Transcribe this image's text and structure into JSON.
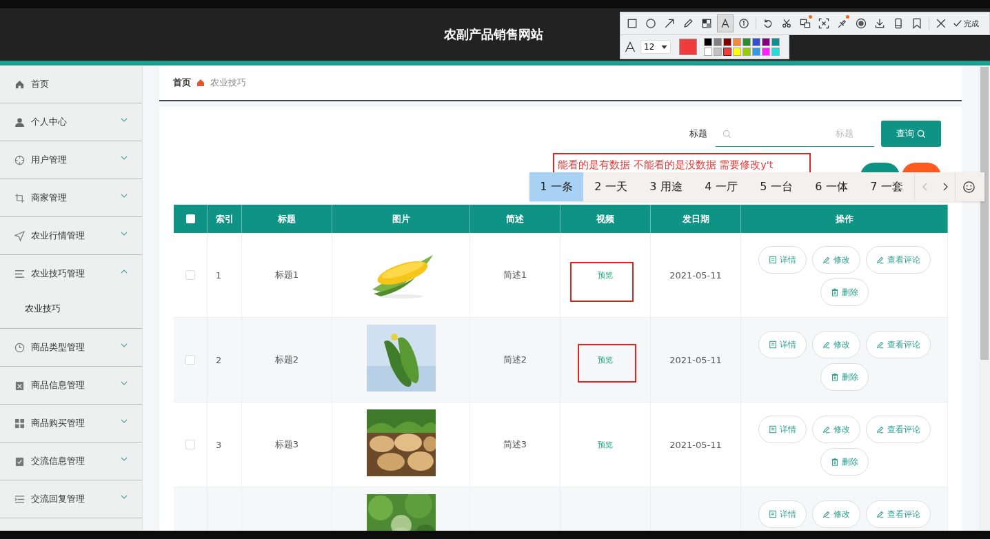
{
  "header": {
    "title": "农副产品销售网站"
  },
  "capture_toolbar": {
    "tools": [
      {
        "selected": false,
        "dot": false
      },
      {
        "selected": false,
        "dot": false
      },
      {
        "selected": false,
        "dot": false
      },
      {
        "selected": false,
        "dot": false
      },
      {
        "selected": false,
        "dot": false
      },
      {
        "selected": true,
        "dot": false
      },
      {
        "selected": false,
        "dot": false
      },
      {
        "selected": false,
        "dot": false
      },
      {
        "selected": false,
        "dot": false
      },
      {
        "selected": false,
        "dot": true
      },
      {
        "selected": false,
        "dot": false
      },
      {
        "selected": false,
        "dot": true
      },
      {
        "selected": false,
        "dot": false
      },
      {
        "selected": false,
        "dot": false
      },
      {
        "selected": false,
        "dot": false
      },
      {
        "selected": false,
        "dot": false
      },
      {
        "selected": false,
        "dot": false
      }
    ],
    "done": "完成",
    "font_size": "12",
    "palette": [
      {
        "color": "#000000",
        "selected": false
      },
      {
        "color": "#808080",
        "selected": false
      },
      {
        "color": "#800000",
        "selected": false
      },
      {
        "color": "#f08a3c",
        "selected": false
      },
      {
        "color": "#2e8b2e",
        "selected": false
      },
      {
        "color": "#3050d0",
        "selected": false
      },
      {
        "color": "#800080",
        "selected": false
      },
      {
        "color": "#108f8f",
        "selected": false
      },
      {
        "color": "#ffffff",
        "selected": false
      },
      {
        "color": "#c0c0c0",
        "selected": false
      },
      {
        "color": "#f03c3c",
        "selected": true
      },
      {
        "color": "#ffff00",
        "selected": false
      },
      {
        "color": "#99cc00",
        "selected": false
      },
      {
        "color": "#3399e6",
        "selected": false
      },
      {
        "color": "#ff22ff",
        "selected": false
      },
      {
        "color": "#22dddd",
        "selected": false
      }
    ]
  },
  "sidebar": {
    "items": [
      {
        "label": "首页",
        "kind": "link"
      },
      {
        "label": "个人中心",
        "kind": "menu",
        "expanded": false
      },
      {
        "label": "用户管理",
        "kind": "menu",
        "expanded": false
      },
      {
        "label": "商家管理",
        "kind": "menu",
        "expanded": false
      },
      {
        "label": "农业行情管理",
        "kind": "menu",
        "expanded": false
      },
      {
        "label": "农业技巧管理",
        "kind": "menu",
        "expanded": true,
        "children": [
          {
            "label": "农业技巧"
          }
        ]
      },
      {
        "label": "商品类型管理",
        "kind": "menu",
        "expanded": false
      },
      {
        "label": "商品信息管理",
        "kind": "menu",
        "expanded": false
      },
      {
        "label": "商品购买管理",
        "kind": "menu",
        "expanded": false
      },
      {
        "label": "交流信息管理",
        "kind": "menu",
        "expanded": false
      },
      {
        "label": "交流回复管理",
        "kind": "menu",
        "expanded": false
      }
    ]
  },
  "breadcrumb": [
    "首页",
    "农业技巧"
  ],
  "search": {
    "label": "标题",
    "placeholder": "标题",
    "button": "查询"
  },
  "annotation": {
    "text": "能看的是有数据 不能看的是没数据 需要修改y't"
  },
  "ime": {
    "candidates": [
      {
        "number": "1",
        "word": "一条",
        "selected": true
      },
      {
        "number": "2",
        "word": "一天",
        "selected": false
      },
      {
        "number": "3",
        "word": "用途",
        "selected": false
      },
      {
        "number": "4",
        "word": "一厅",
        "selected": false
      },
      {
        "number": "5",
        "word": "一台",
        "selected": false
      },
      {
        "number": "6",
        "word": "一体",
        "selected": false
      },
      {
        "number": "7",
        "word": "一套",
        "selected": false
      }
    ]
  },
  "table": {
    "select_all_checked": false,
    "columns": [
      "索引",
      "标题",
      "图片",
      "简述",
      "视频",
      "发日期",
      "操作"
    ],
    "rows": [
      {
        "checked": false,
        "index": "1",
        "title": "标题1",
        "picture": {
          "kind": "picture"
        },
        "summary": "简述1",
        "video": "预览",
        "date": "2021-05-11",
        "marked": true,
        "actions": [
          "详情",
          "修改",
          "查看评论",
          "删除"
        ]
      },
      {
        "checked": false,
        "index": "2",
        "title": "标题2",
        "picture": {
          "kind": "picture"
        },
        "summary": "简述2",
        "video": "预览",
        "date": "2021-05-11",
        "marked": true,
        "actions": [
          "详情",
          "修改",
          "查看评论",
          "删除"
        ]
      },
      {
        "checked": false,
        "index": "3",
        "title": "标题3",
        "picture": {
          "kind": "picture"
        },
        "summary": "简述3",
        "video": "预览",
        "date": "2021-05-11",
        "marked": false,
        "actions": [
          "详情",
          "修改",
          "查看评论",
          "删除"
        ]
      },
      {
        "picture": {
          "kind": "picture"
        },
        "marked": false,
        "actions": [
          "详情",
          "修改",
          "查看评论"
        ]
      }
    ]
  }
}
